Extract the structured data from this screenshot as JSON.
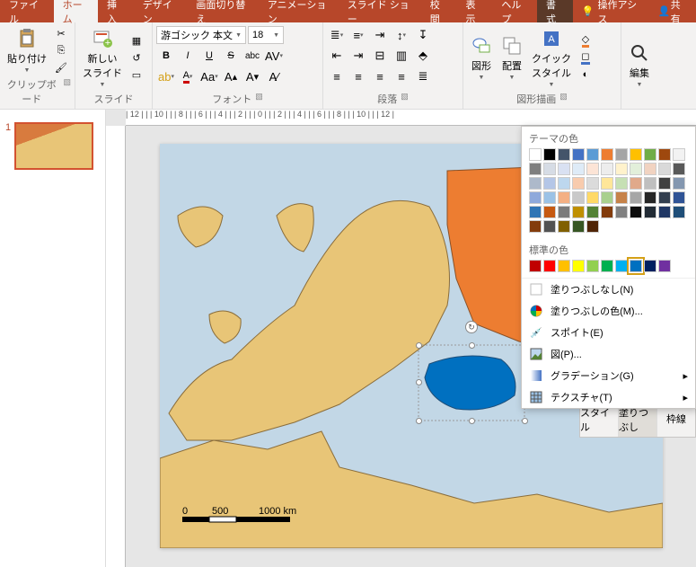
{
  "tabs": {
    "file": "ファイル",
    "home": "ホーム",
    "insert": "挿入",
    "design": "デザイン",
    "transition": "画面切り替え",
    "animation": "アニメーション",
    "slideshow": "スライド ショー",
    "review": "校閲",
    "view": "表示",
    "help": "ヘルプ",
    "format": "書式",
    "tell": "操作アシス",
    "share": "共有"
  },
  "ribbon": {
    "clipboard": {
      "paste": "貼り付け",
      "label": "クリップボード"
    },
    "slides": {
      "new": "新しい\nスライド",
      "label": "スライド"
    },
    "font": {
      "name": "游ゴシック 本文",
      "size": "18",
      "label": "フォント"
    },
    "paragraph": {
      "label": "段落"
    },
    "drawing": {
      "shapes": "図形",
      "arrange": "配置",
      "quick": "クイック\nスタイル",
      "label": "図形描画"
    },
    "editing": {
      "label": "編集"
    }
  },
  "thumb": {
    "num": "1"
  },
  "ruler": {
    "h": "| 12 | | | 10 | | | 8 | | | 6 | | | 4 | | | 2 | | | 0 | | | 2 | | | 4 | | | 6 | | | 8 | | | 10 | | | 12 |"
  },
  "scale": {
    "z": "0",
    "m1": "500",
    "m2": "1000 km"
  },
  "popup": {
    "theme": "テーマの色",
    "standard": "標準の色",
    "nofill": "塗りつぶしなし(N)",
    "morefill": "塗りつぶしの色(M)...",
    "eyedrop": "スポイト(E)",
    "picture": "図(P)...",
    "gradient": "グラデーション(G)",
    "texture": "テクスチャ(T)"
  },
  "mini": {
    "style": "スタイル",
    "fill": "塗りつぶし",
    "outline": "枠線"
  },
  "theme_colors": [
    "#ffffff",
    "#000000",
    "#44546a",
    "#4472c4",
    "#5b9bd5",
    "#ed7d31",
    "#a5a5a5",
    "#ffc000",
    "#70ad47",
    "#9e480e"
  ],
  "theme_tints": [
    [
      "#f2f2f2",
      "#7f7f7f",
      "#d6dce5",
      "#d9e1f2",
      "#deebf7",
      "#fce4d6",
      "#ededed",
      "#fff2cc",
      "#e2efda",
      "#f1d3c1"
    ],
    [
      "#d9d9d9",
      "#595959",
      "#adb9ca",
      "#b4c6e7",
      "#bdd7ee",
      "#f8cbad",
      "#dbdbdb",
      "#ffe699",
      "#c6e0b4",
      "#e0a98a"
    ],
    [
      "#bfbfbf",
      "#404040",
      "#8497b0",
      "#8ea9db",
      "#9bc2e6",
      "#f4b084",
      "#c9c9c9",
      "#ffd966",
      "#a9d08e",
      "#c68249"
    ],
    [
      "#a6a6a6",
      "#262626",
      "#333f4f",
      "#305496",
      "#2f75b5",
      "#c65911",
      "#7b7b7b",
      "#bf8f00",
      "#548235",
      "#833c0c"
    ],
    [
      "#808080",
      "#0d0d0d",
      "#222b35",
      "#203764",
      "#1f4e78",
      "#833c0c",
      "#525252",
      "#806000",
      "#375623",
      "#4f2406"
    ]
  ],
  "standard_colors": [
    "#c00000",
    "#ff0000",
    "#ffc000",
    "#ffff00",
    "#92d050",
    "#00b050",
    "#00b0f0",
    "#0070c0",
    "#002060",
    "#7030a0"
  ]
}
